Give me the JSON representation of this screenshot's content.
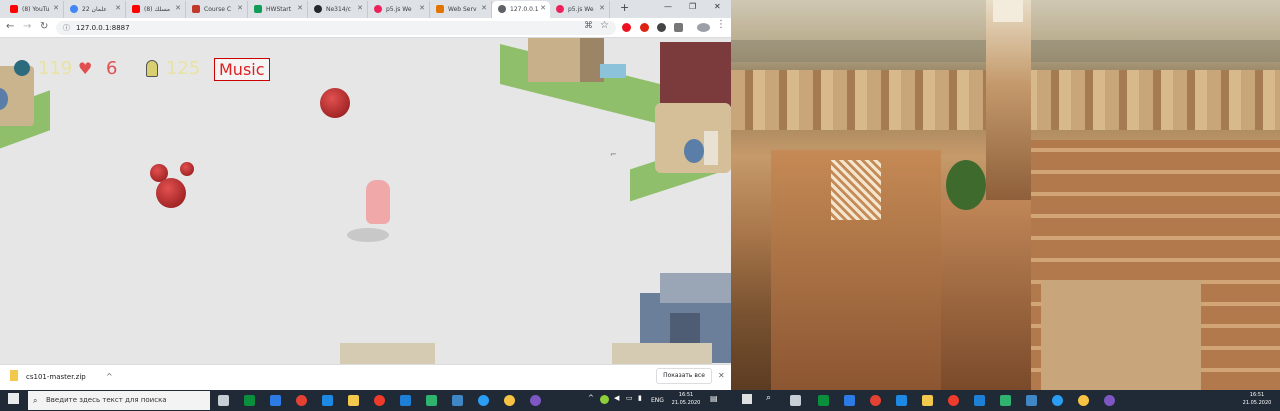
{
  "browser": {
    "tabs": [
      {
        "label": "(8) YouTu",
        "color": "#ff0000"
      },
      {
        "label": "علمان 22",
        "color": "#4285f4"
      },
      {
        "label": "(8) مسلك",
        "color": "#ff0000"
      },
      {
        "label": "Course C",
        "color": "#c0392b"
      },
      {
        "label": "HWStart",
        "color": "#0f9d58"
      },
      {
        "label": "Ne314/c",
        "color": "#24292e"
      },
      {
        "label": "p5.js We",
        "color": "#ed225d"
      },
      {
        "label": "Web Serv",
        "color": "#e37400"
      },
      {
        "label": "127.0.0.1",
        "color": "#5f6368"
      },
      {
        "label": "p5.js We",
        "color": "#ed225d"
      }
    ],
    "new_tab": "+",
    "url": "127.0.0.1:8887",
    "window_controls": {
      "minimize": "—",
      "maximize": "❐",
      "close": "✕"
    }
  },
  "game": {
    "hud_virus_count": "119",
    "hud_lives": "6",
    "hud_people": "125",
    "music_button": "Music",
    "colors": {
      "virus": "#e07a6a",
      "lives": "#e05050",
      "people": "#e8e3a0",
      "music": "#d22222"
    }
  },
  "downloads": {
    "file_name": "cs101-master.zip",
    "chevron": "^",
    "show_all": "Показать все",
    "close": "✕"
  },
  "taskbar_left": {
    "search_placeholder": "Введите здесь текст для поиска",
    "language": "ENG",
    "time": "16:51",
    "date": "21.05.2020"
  },
  "taskbar_right": {
    "time": "16:51",
    "date": "21.05.2020"
  }
}
